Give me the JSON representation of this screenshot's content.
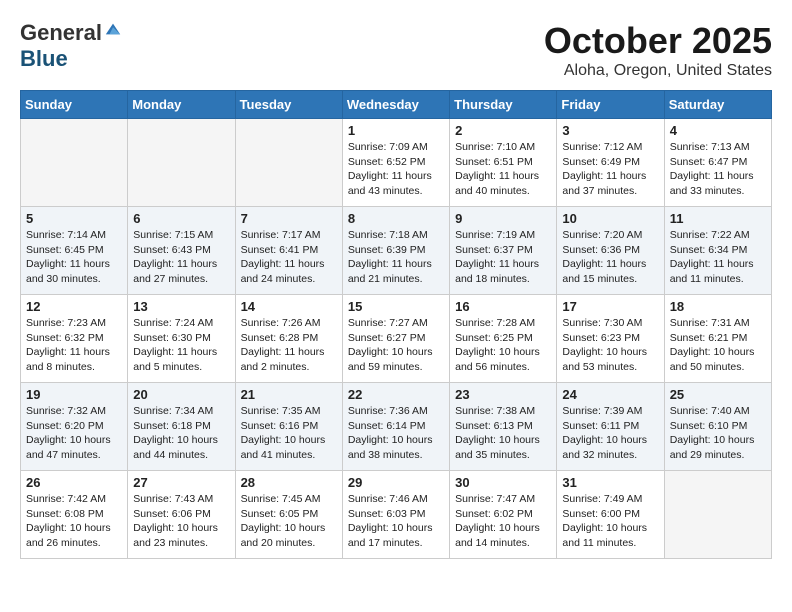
{
  "logo": {
    "general": "General",
    "blue": "Blue"
  },
  "title": "October 2025",
  "location": "Aloha, Oregon, United States",
  "days_of_week": [
    "Sunday",
    "Monday",
    "Tuesday",
    "Wednesday",
    "Thursday",
    "Friday",
    "Saturday"
  ],
  "weeks": [
    [
      {
        "day": "",
        "info": ""
      },
      {
        "day": "",
        "info": ""
      },
      {
        "day": "",
        "info": ""
      },
      {
        "day": "1",
        "info": "Sunrise: 7:09 AM\nSunset: 6:52 PM\nDaylight: 11 hours and 43 minutes."
      },
      {
        "day": "2",
        "info": "Sunrise: 7:10 AM\nSunset: 6:51 PM\nDaylight: 11 hours and 40 minutes."
      },
      {
        "day": "3",
        "info": "Sunrise: 7:12 AM\nSunset: 6:49 PM\nDaylight: 11 hours and 37 minutes."
      },
      {
        "day": "4",
        "info": "Sunrise: 7:13 AM\nSunset: 6:47 PM\nDaylight: 11 hours and 33 minutes."
      }
    ],
    [
      {
        "day": "5",
        "info": "Sunrise: 7:14 AM\nSunset: 6:45 PM\nDaylight: 11 hours and 30 minutes."
      },
      {
        "day": "6",
        "info": "Sunrise: 7:15 AM\nSunset: 6:43 PM\nDaylight: 11 hours and 27 minutes."
      },
      {
        "day": "7",
        "info": "Sunrise: 7:17 AM\nSunset: 6:41 PM\nDaylight: 11 hours and 24 minutes."
      },
      {
        "day": "8",
        "info": "Sunrise: 7:18 AM\nSunset: 6:39 PM\nDaylight: 11 hours and 21 minutes."
      },
      {
        "day": "9",
        "info": "Sunrise: 7:19 AM\nSunset: 6:37 PM\nDaylight: 11 hours and 18 minutes."
      },
      {
        "day": "10",
        "info": "Sunrise: 7:20 AM\nSunset: 6:36 PM\nDaylight: 11 hours and 15 minutes."
      },
      {
        "day": "11",
        "info": "Sunrise: 7:22 AM\nSunset: 6:34 PM\nDaylight: 11 hours and 11 minutes."
      }
    ],
    [
      {
        "day": "12",
        "info": "Sunrise: 7:23 AM\nSunset: 6:32 PM\nDaylight: 11 hours and 8 minutes."
      },
      {
        "day": "13",
        "info": "Sunrise: 7:24 AM\nSunset: 6:30 PM\nDaylight: 11 hours and 5 minutes."
      },
      {
        "day": "14",
        "info": "Sunrise: 7:26 AM\nSunset: 6:28 PM\nDaylight: 11 hours and 2 minutes."
      },
      {
        "day": "15",
        "info": "Sunrise: 7:27 AM\nSunset: 6:27 PM\nDaylight: 10 hours and 59 minutes."
      },
      {
        "day": "16",
        "info": "Sunrise: 7:28 AM\nSunset: 6:25 PM\nDaylight: 10 hours and 56 minutes."
      },
      {
        "day": "17",
        "info": "Sunrise: 7:30 AM\nSunset: 6:23 PM\nDaylight: 10 hours and 53 minutes."
      },
      {
        "day": "18",
        "info": "Sunrise: 7:31 AM\nSunset: 6:21 PM\nDaylight: 10 hours and 50 minutes."
      }
    ],
    [
      {
        "day": "19",
        "info": "Sunrise: 7:32 AM\nSunset: 6:20 PM\nDaylight: 10 hours and 47 minutes."
      },
      {
        "day": "20",
        "info": "Sunrise: 7:34 AM\nSunset: 6:18 PM\nDaylight: 10 hours and 44 minutes."
      },
      {
        "day": "21",
        "info": "Sunrise: 7:35 AM\nSunset: 6:16 PM\nDaylight: 10 hours and 41 minutes."
      },
      {
        "day": "22",
        "info": "Sunrise: 7:36 AM\nSunset: 6:14 PM\nDaylight: 10 hours and 38 minutes."
      },
      {
        "day": "23",
        "info": "Sunrise: 7:38 AM\nSunset: 6:13 PM\nDaylight: 10 hours and 35 minutes."
      },
      {
        "day": "24",
        "info": "Sunrise: 7:39 AM\nSunset: 6:11 PM\nDaylight: 10 hours and 32 minutes."
      },
      {
        "day": "25",
        "info": "Sunrise: 7:40 AM\nSunset: 6:10 PM\nDaylight: 10 hours and 29 minutes."
      }
    ],
    [
      {
        "day": "26",
        "info": "Sunrise: 7:42 AM\nSunset: 6:08 PM\nDaylight: 10 hours and 26 minutes."
      },
      {
        "day": "27",
        "info": "Sunrise: 7:43 AM\nSunset: 6:06 PM\nDaylight: 10 hours and 23 minutes."
      },
      {
        "day": "28",
        "info": "Sunrise: 7:45 AM\nSunset: 6:05 PM\nDaylight: 10 hours and 20 minutes."
      },
      {
        "day": "29",
        "info": "Sunrise: 7:46 AM\nSunset: 6:03 PM\nDaylight: 10 hours and 17 minutes."
      },
      {
        "day": "30",
        "info": "Sunrise: 7:47 AM\nSunset: 6:02 PM\nDaylight: 10 hours and 14 minutes."
      },
      {
        "day": "31",
        "info": "Sunrise: 7:49 AM\nSunset: 6:00 PM\nDaylight: 10 hours and 11 minutes."
      },
      {
        "day": "",
        "info": ""
      }
    ]
  ]
}
